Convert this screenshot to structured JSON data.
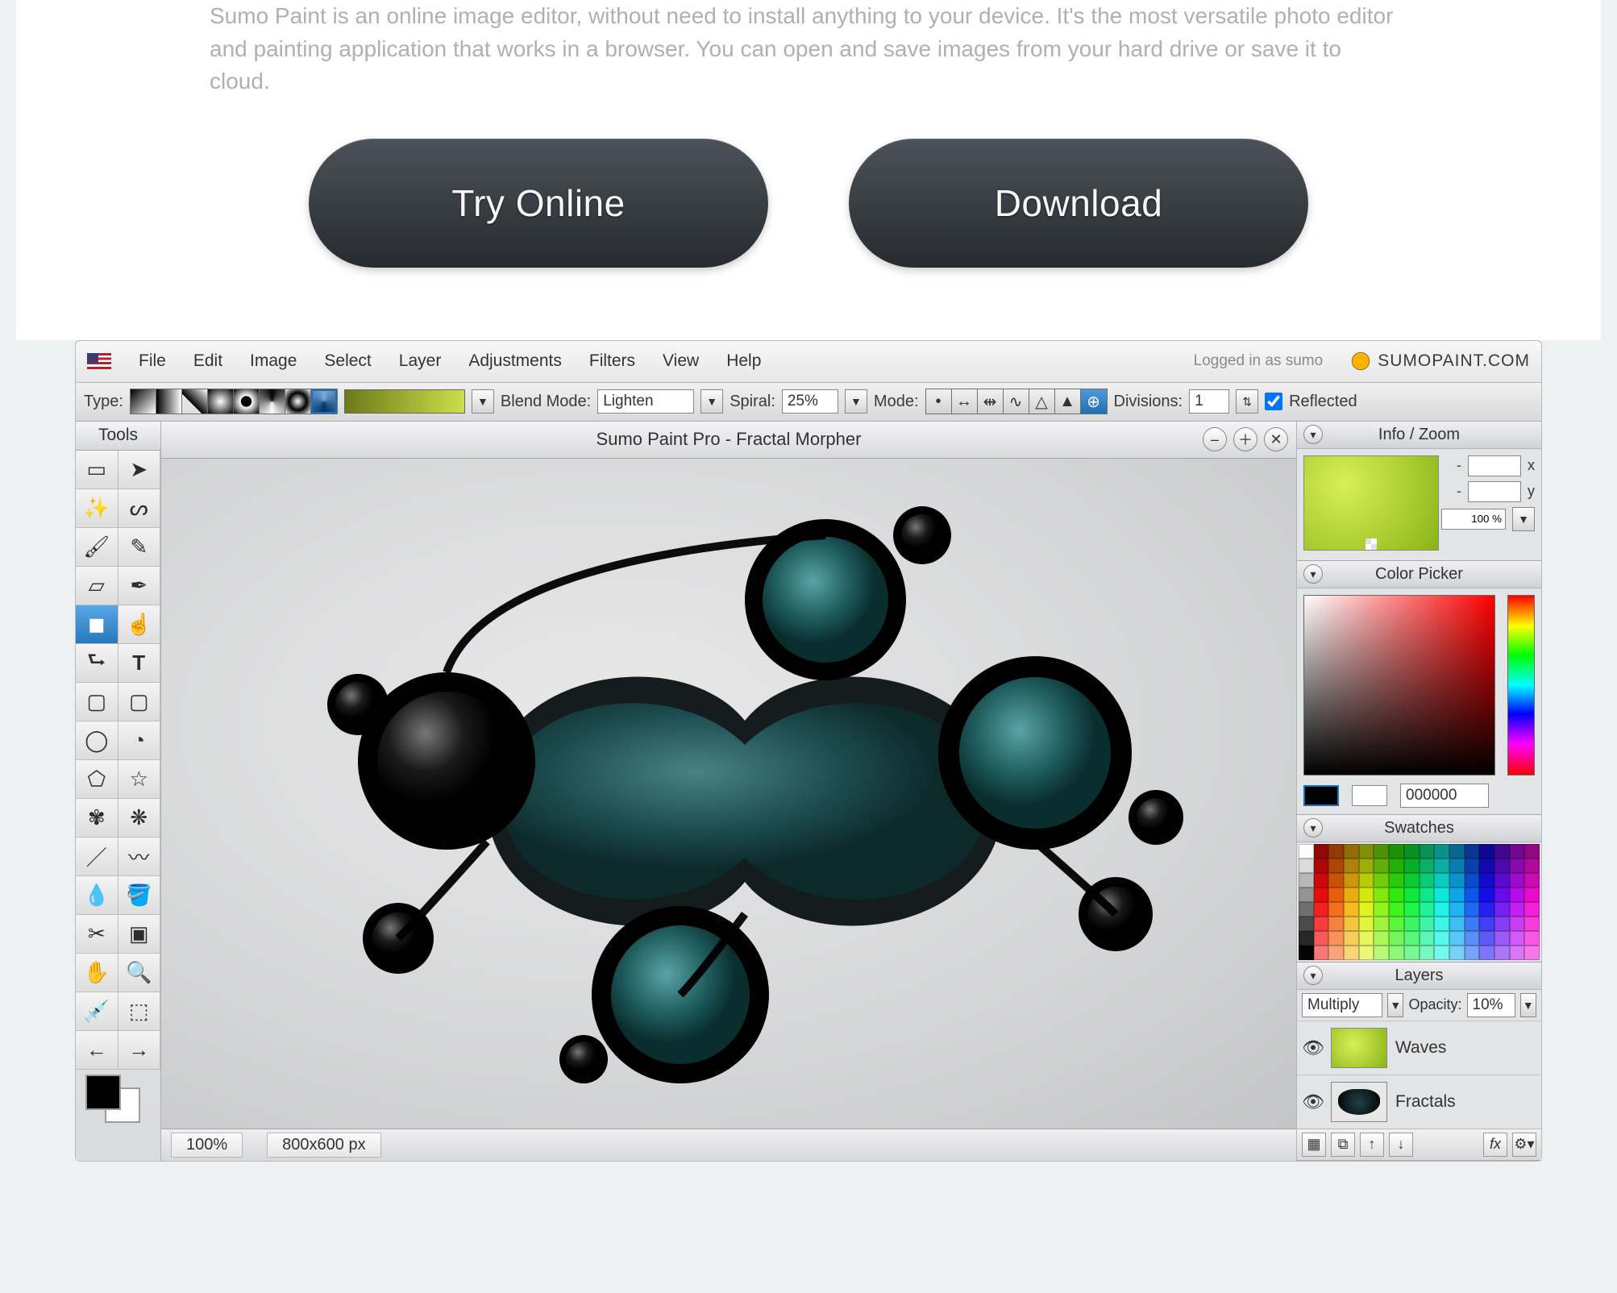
{
  "hero": {
    "description": "Sumo Paint is an online image editor, without need to install anything to your device. It's the most versatile photo editor and painting application that works in a browser. You can open and save images from your hard drive or save it to cloud.",
    "try_online": "Try Online",
    "download": "Download"
  },
  "menubar": {
    "items": [
      "File",
      "Edit",
      "Image",
      "Select",
      "Layer",
      "Adjustments",
      "Filters",
      "View",
      "Help"
    ],
    "logged_in": "Logged in as sumo",
    "brand": "SUMOPAINT.COM"
  },
  "options": {
    "type_label": "Type:",
    "blend_label": "Blend Mode:",
    "blend_value": "Lighten",
    "spiral_label": "Spiral:",
    "spiral_value": "25%",
    "mode_label": "Mode:",
    "divisions_label": "Divisions:",
    "divisions_value": "1",
    "reflected_label": "Reflected"
  },
  "tools_title": "Tools",
  "document": {
    "title": "Sumo Paint Pro - Fractal Morpher"
  },
  "status": {
    "zoom": "100%",
    "dims": "800x600 px"
  },
  "panels": {
    "info": {
      "title": "Info / Zoom",
      "x": "-",
      "x_label": "x",
      "y": "-",
      "y_label": "y",
      "zoom": "100 %"
    },
    "picker": {
      "title": "Color Picker",
      "hex": "000000"
    },
    "swatches": {
      "title": "Swatches"
    },
    "layers": {
      "title": "Layers",
      "blend": "Multiply",
      "opacity_label": "Opacity:",
      "opacity_value": "10%",
      "items": [
        {
          "name": "Waves"
        },
        {
          "name": "Fractals"
        }
      ]
    }
  }
}
